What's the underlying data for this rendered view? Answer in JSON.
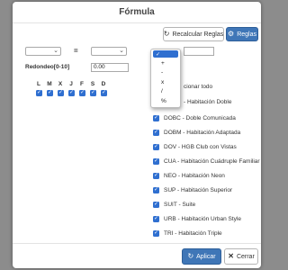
{
  "dialog": {
    "title": "Fórmula"
  },
  "toolbar": {
    "recalc_label": "Recalcular Reglas",
    "recalc_icon": "refresh-icon",
    "rules_label": "Reglas",
    "rules_icon": "gear-icon"
  },
  "formula": {
    "equals_label": "=",
    "operator_options": [
      "",
      "+",
      "-",
      "x",
      "/",
      "%"
    ],
    "operator_selected": ""
  },
  "rounding": {
    "label": "Redondeo[0-10]",
    "value": "0.00"
  },
  "days": [
    "L",
    "M",
    "X",
    "J",
    "F",
    "S",
    "D"
  ],
  "rooms": {
    "select_all_label": "Seleccionar todo",
    "select_all_visible": "cionar todo",
    "items": [
      "DOBL - Habitación Doble",
      "DOBC - Doble Comunicada",
      "DOBM - Habitación Adaptada",
      "DOV - HGB Club con Vistas",
      "CUA - Habitación Cuádruple Familiar",
      "NEO - Habitación Neon",
      "SUP - Habitación Superior",
      "SUIT - Suite",
      "URB - Habitación Urban Style",
      "TRI - Habitación Triple"
    ],
    "first_item_visible": "- Habitación Doble"
  },
  "footer": {
    "apply_label": "Aplicar",
    "close_label": "Cerrar"
  },
  "colors": {
    "primary": "#3f76b7",
    "checkbox": "#2f6fd0",
    "overlay": "#8c8c8c"
  }
}
